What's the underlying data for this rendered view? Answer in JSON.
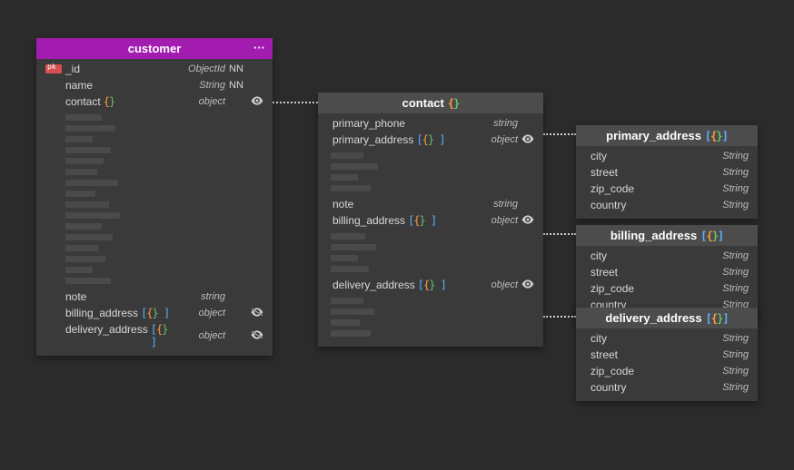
{
  "customer": {
    "title": "customer",
    "more": "···",
    "fields": [
      {
        "name": "_id",
        "type": "ObjectId",
        "nn": "NN",
        "pk": true
      },
      {
        "name": "name",
        "type": "String",
        "nn": "NN"
      },
      {
        "name": "contact",
        "type": "object",
        "braces": true,
        "eye": true
      }
    ],
    "tail": [
      {
        "name": "note",
        "type": "string"
      },
      {
        "name": "billing_address",
        "type": "object",
        "bracketsBraces": true,
        "eyeOff": true
      },
      {
        "name": "delivery_address",
        "type": "object",
        "bracketsBraces": true,
        "eyeOff": true
      }
    ]
  },
  "contact": {
    "title": "contact",
    "fields": [
      {
        "name": "primary_phone",
        "type": "string"
      },
      {
        "name": "primary_address",
        "type": "object",
        "bracketsBraces": true,
        "eye": true
      }
    ],
    "mid": [
      {
        "name": "note",
        "type": "string"
      },
      {
        "name": "billing_address",
        "type": "object",
        "bracketsBraces": true,
        "eye": true
      }
    ],
    "tail": [
      {
        "name": "delivery_address",
        "type": "object",
        "bracketsBraces": true,
        "eye": true
      }
    ]
  },
  "primary_address": {
    "title": "primary_address",
    "fields": [
      {
        "name": "city",
        "type": "String"
      },
      {
        "name": "street",
        "type": "String"
      },
      {
        "name": "zip_code",
        "type": "String"
      },
      {
        "name": "country",
        "type": "String"
      }
    ]
  },
  "billing_address": {
    "title": "billing_address",
    "fields": [
      {
        "name": "city",
        "type": "String"
      },
      {
        "name": "street",
        "type": "String"
      },
      {
        "name": "zip_code",
        "type": "String"
      },
      {
        "name": "country",
        "type": "String"
      }
    ]
  },
  "delivery_address": {
    "title": "delivery_address",
    "fields": [
      {
        "name": "city",
        "type": "String"
      },
      {
        "name": "street",
        "type": "String"
      },
      {
        "name": "zip_code",
        "type": "String"
      },
      {
        "name": "country",
        "type": "String"
      }
    ]
  }
}
